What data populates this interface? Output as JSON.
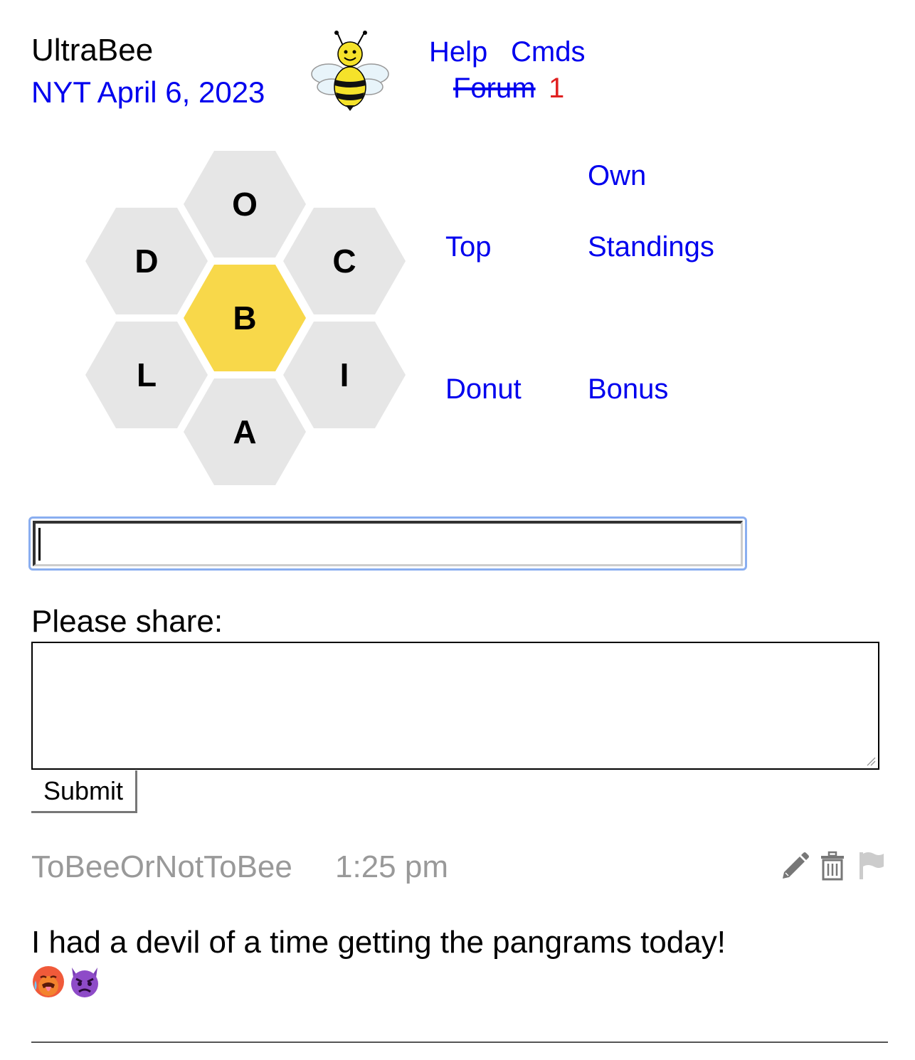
{
  "header": {
    "app_title": "UltraBee",
    "date_label": "NYT April 6, 2023",
    "help_label": "Help",
    "cmds_label": "Cmds",
    "forum_label": "Forum",
    "forum_count": "1"
  },
  "hive": {
    "center_letter": "B",
    "outer_letters": {
      "top": "O",
      "upper_left": "D",
      "upper_right": "C",
      "lower_left": "L",
      "lower_right": "I",
      "bottom": "A"
    },
    "center_color": "#f8d84a",
    "outer_color": "#e6e6e6"
  },
  "nav": {
    "own": "Own",
    "top": "Top",
    "standings": "Standings",
    "donut": "Donut",
    "bonus": "Bonus"
  },
  "word_input": {
    "value": ""
  },
  "share": {
    "label": "Please share:",
    "textarea_value": "",
    "submit_label": "Submit"
  },
  "post": {
    "username": "ToBeeOrNotToBee",
    "time": "1:25 pm",
    "text": "I had a devil of a time getting the pangrams today!",
    "emojis": [
      "hot-face-emoji",
      "angry-devil-emoji"
    ],
    "icons": [
      "pencil-icon",
      "trash-icon",
      "flag-icon"
    ]
  },
  "colors": {
    "link": "#0000ee",
    "forum_count": "#e02020",
    "muted": "#999999"
  }
}
